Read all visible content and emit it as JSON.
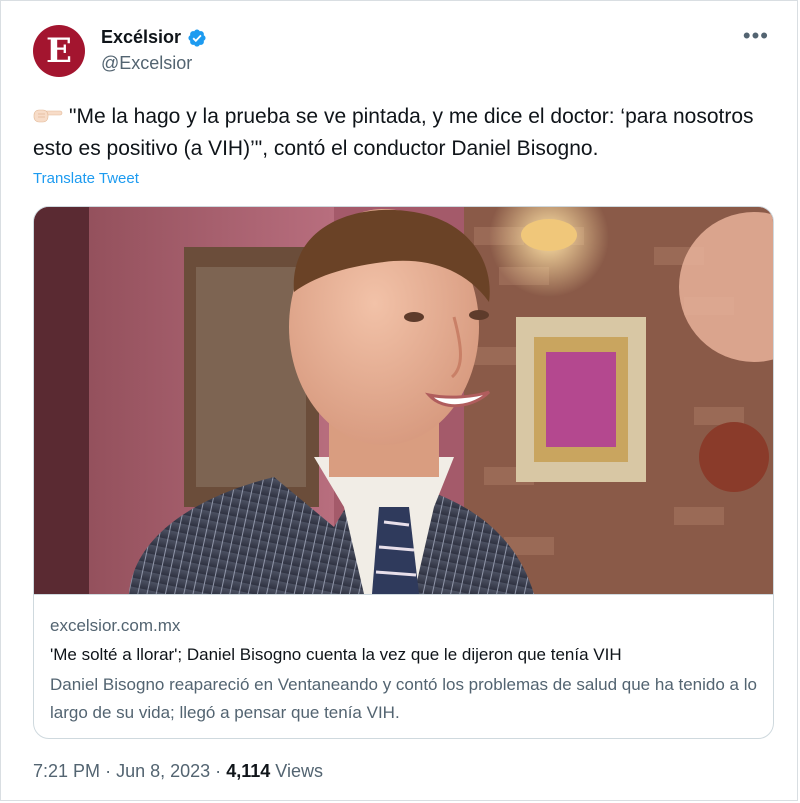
{
  "account": {
    "avatar_letter": "E",
    "display_name": "Excélsior",
    "handle": "@Excelsior",
    "avatar_color": "#a3152f",
    "verified_color": "#1d9bf0"
  },
  "tweet": {
    "text": "\"Me la hago y la prueba se ve pintada, y me dice el doctor: ‘para nosotros esto es positivo (a VIH)’\", contó el conductor Daniel Bisogno.",
    "translate_label": "Translate Tweet"
  },
  "card": {
    "domain": "excelsior.com.mx",
    "title": "'Me solté a llorar'; Daniel Bisogno cuenta la vez que le dijeron que tenía VIH",
    "description": "Daniel Bisogno reapareció en Ventaneando y contó los problemas de salud que ha tenido a lo largo de su vida; llegó a pensar que tenía VIH."
  },
  "meta": {
    "time": "7:21 PM",
    "separator": "·",
    "date": "Jun 8, 2023",
    "views_count": "4,114",
    "views_label": "Views"
  },
  "icons": {
    "verified": "verified-badge-icon",
    "more": "more-options-icon",
    "emoji": "pointing-hand-icon"
  }
}
